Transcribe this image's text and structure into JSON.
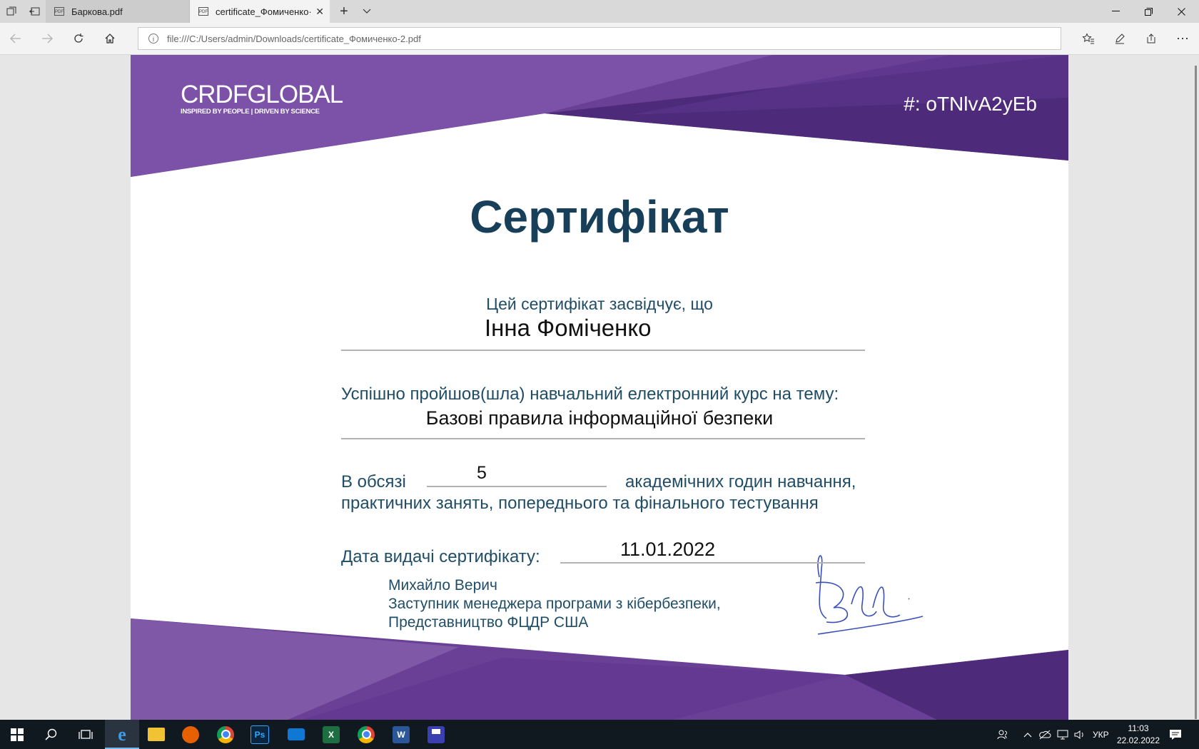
{
  "browser": {
    "tabs": [
      {
        "label": "Баркова.pdf",
        "active": false
      },
      {
        "label": "certificate_Фомиченко·",
        "active": true
      }
    ],
    "new_tab_icon": "plus-icon",
    "address": {
      "url": "file:///C:/Users/admin/Downloads/certificate_Фомиченко-2.pdf"
    }
  },
  "certificate": {
    "logo_text": "CRDFGLOBAL",
    "logo_tagline": "INSPIRED BY PEOPLE | DRIVEN BY SCIENCE",
    "id_label": "#: oTNlvA2yEb",
    "title": "Сертифікат",
    "certifies_text": "Цей сертифікат засвідчує, що",
    "recipient_name": "Інна Фоміченко",
    "completed_text": "Успішно пройшов(шла) навчальний електронний курс на тему:",
    "course_name": "Базові правила інформаційної безпеки",
    "volume_prefix": "В обсязі",
    "hours": "5",
    "volume_suffix": "академічних годин навчання,",
    "volume_line2": "практичних занять, попереднього та фінального тестування",
    "date_label": "Дата видачі сертифікату:",
    "date_value": "11.01.2022",
    "signer_name": "Михайло Верич",
    "signer_position": "Заступник менеджера програми з кібербезпеки,",
    "signer_org": "Представництво ФЦДР США",
    "colors": {
      "purple_dark": "#4e2a7a",
      "purple_mid": "#6a3f96",
      "purple_light": "#7b52a8",
      "text": "#1f4d66",
      "title": "#173f5a"
    }
  },
  "taskbar": {
    "language": "УКР",
    "time": "11:03",
    "date": "22.02.2022"
  }
}
